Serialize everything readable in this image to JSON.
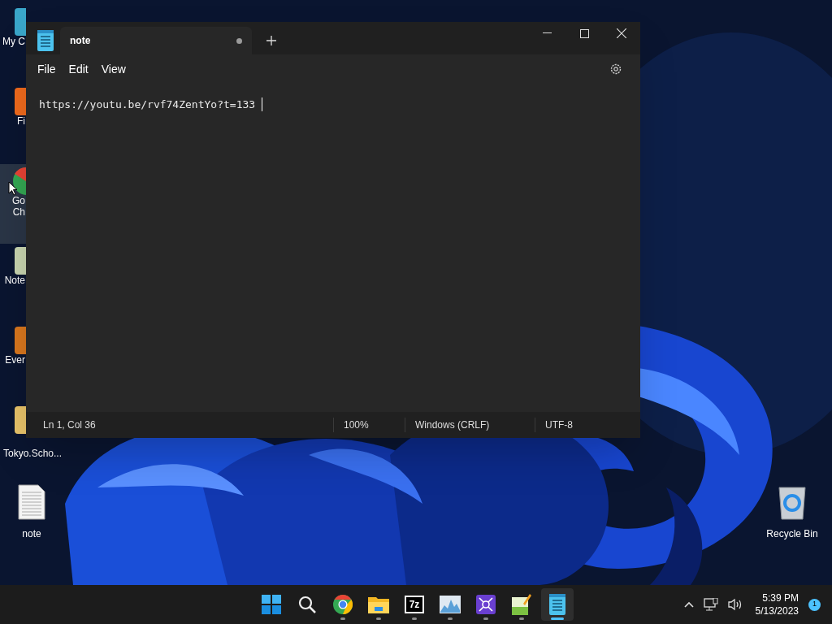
{
  "desktop_icons": [
    {
      "kind": "monitor",
      "label": "My C",
      "selected": false
    },
    {
      "kind": "firefox",
      "label": "Fi",
      "selected": false
    },
    {
      "kind": "chrome",
      "label": "Go Ch",
      "selected": true
    },
    {
      "kind": "notebook",
      "label": "Note",
      "selected": false
    },
    {
      "kind": "orange",
      "label": "Ever",
      "selected": false
    },
    {
      "kind": "folder",
      "label": "Tokyo.Scho...",
      "selected": false
    }
  ],
  "desktop_files": [
    {
      "kind": "document",
      "label": "note"
    },
    {
      "kind": "recycle",
      "label": "Recycle Bin"
    }
  ],
  "window": {
    "tab": {
      "title": "note",
      "unsaved": true
    },
    "menu": [
      "File",
      "Edit",
      "View"
    ],
    "text": "https://youtu.be/rvf74ZentYo?t=133",
    "status_bar": [
      "Ln 1, Col 36",
      "100%",
      "Windows (CRLF)",
      "UTF-8"
    ]
  },
  "taskbar": {
    "apps": [
      {
        "kind": "start",
        "running": false,
        "active": false
      },
      {
        "kind": "search",
        "running": false,
        "active": false
      },
      {
        "kind": "chrome",
        "running": true,
        "active": false
      },
      {
        "kind": "explorer",
        "running": true,
        "active": false
      },
      {
        "kind": "sevenzip",
        "label": "7z",
        "running": true,
        "active": false
      },
      {
        "kind": "monitor",
        "running": true,
        "active": false
      },
      {
        "kind": "purple",
        "running": true,
        "active": false
      },
      {
        "kind": "editor",
        "running": true,
        "active": false
      },
      {
        "kind": "notepad",
        "running": true,
        "active": true
      }
    ],
    "time": "5:39 PM",
    "date": "5/13/2023",
    "notifications": "1"
  }
}
